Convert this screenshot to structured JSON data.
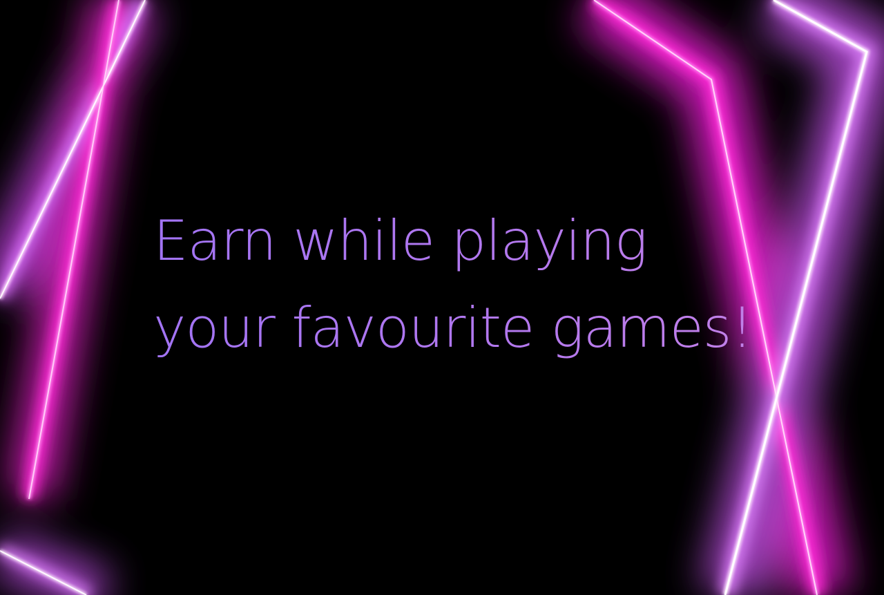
{
  "headline": {
    "line1": "Earn while playing",
    "line2": "your favourite games!"
  },
  "colors": {
    "background": "#000000",
    "neon_pink": "#ff2bd6",
    "neon_purple": "#c24de6",
    "neon_core": "#ffe6ff",
    "text_gradient_start": "#a274f4",
    "text_gradient_end": "#c583e6"
  }
}
